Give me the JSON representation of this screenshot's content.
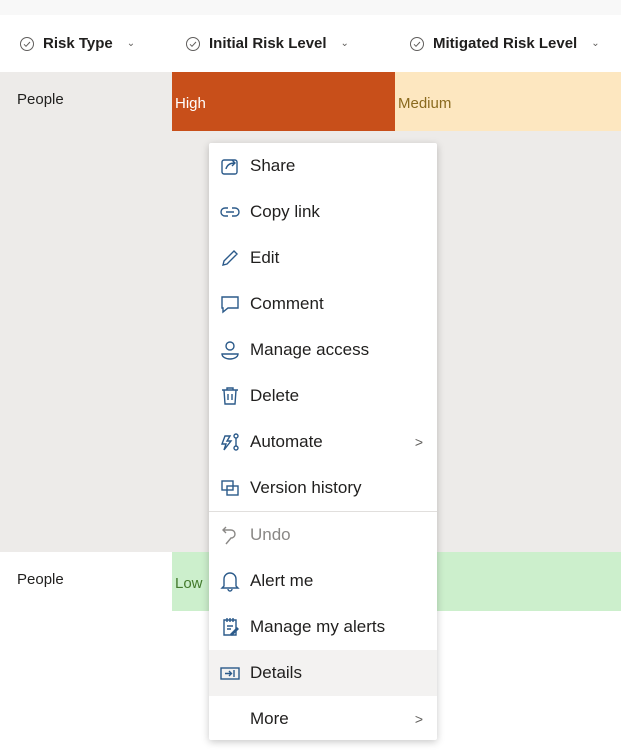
{
  "columns": [
    {
      "label": "Risk Type"
    },
    {
      "label": "Initial Risk Level"
    },
    {
      "label": "Mitigated Risk Level"
    }
  ],
  "rows": [
    {
      "risk_type": "People",
      "initial": "High",
      "mitigated": "Medium"
    },
    {
      "risk_type": "People",
      "initial": "Low"
    }
  ],
  "colors": {
    "high": "#c84f1a",
    "medium": "#fde7c0",
    "low": "#ccefcc",
    "row_selected": "#edebe9"
  },
  "menu": {
    "items": [
      {
        "label": "Share",
        "icon": "share-icon"
      },
      {
        "label": "Copy link",
        "icon": "link-icon"
      },
      {
        "label": "Edit",
        "icon": "pencil-icon"
      },
      {
        "label": "Comment",
        "icon": "comment-icon"
      },
      {
        "label": "Manage access",
        "icon": "person-icon"
      },
      {
        "label": "Delete",
        "icon": "trash-icon"
      },
      {
        "label": "Automate",
        "icon": "automate-icon",
        "submenu": true
      },
      {
        "label": "Version history",
        "icon": "history-icon"
      },
      {
        "label": "Undo",
        "icon": "undo-icon",
        "disabled": true
      },
      {
        "label": "Alert me",
        "icon": "bell-icon"
      },
      {
        "label": "Manage my alerts",
        "icon": "alerts-icon"
      },
      {
        "label": "Details",
        "icon": "details-icon",
        "highlighted": true
      },
      {
        "label": "More",
        "submenu": true
      }
    ],
    "submenu_glyph": ">"
  }
}
